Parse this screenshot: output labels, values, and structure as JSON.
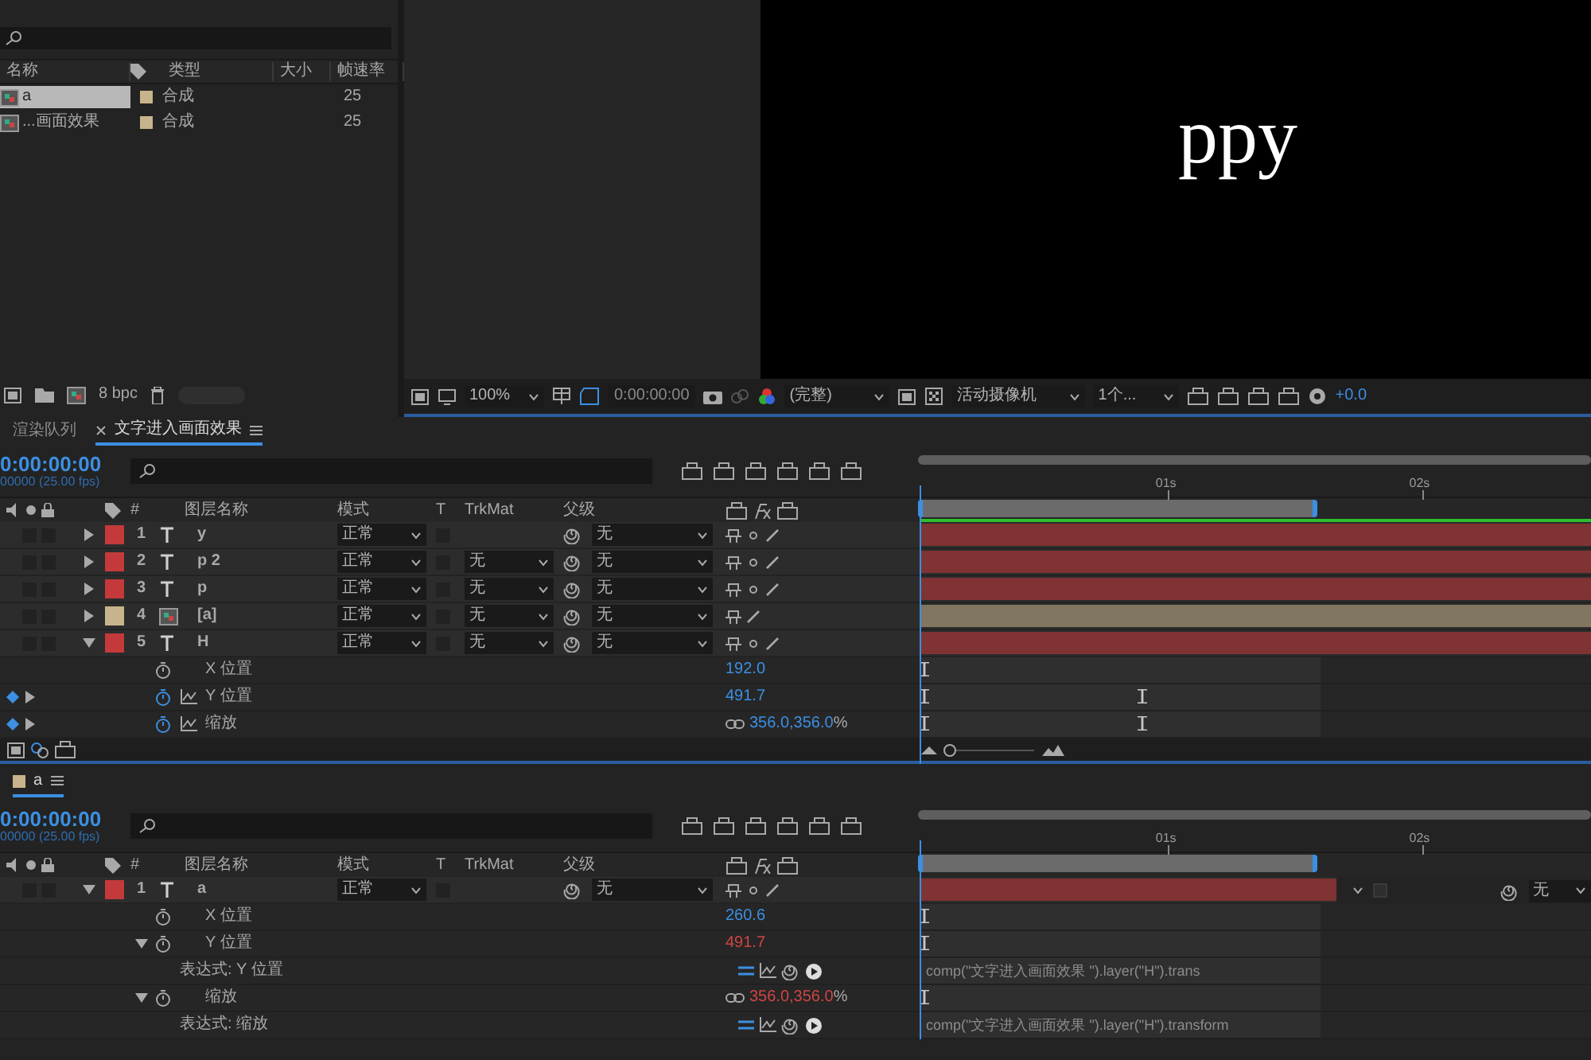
{
  "project": {
    "columns": [
      "名称",
      "类型",
      "大小",
      "帧速率"
    ],
    "items": [
      {
        "name": "a",
        "type": "合成",
        "fps": "25",
        "selected": true
      },
      {
        "name": "...画面效果",
        "type": "合成",
        "fps": "25",
        "selected": false
      }
    ],
    "bpc": "8 bpc"
  },
  "viewer": {
    "text": "ppy",
    "zoom": "100%",
    "timecode": "0:00:00:00",
    "resolution": "(完整)",
    "camera": "活动摄像机",
    "views": "1个...",
    "exposure": "+0.0"
  },
  "timelines": [
    {
      "tabs": [
        {
          "label": "渲染队列",
          "selected": false,
          "closable": false
        },
        {
          "label": "文字进入画面效果",
          "selected": true,
          "closable": true
        }
      ],
      "timecode": "0:00:00:00",
      "fps": "00000 (25.00 fps)",
      "headers": {
        "index": "#",
        "name": "图层名称",
        "mode": "模式",
        "t": "T",
        "trkmat": "TrkMat",
        "parent": "父级"
      },
      "ruler": [
        "01s",
        "02s"
      ],
      "layers": [
        {
          "index": "1",
          "kind": "text",
          "name": "y",
          "color": "#c43a3a",
          "expanded": false,
          "mode": "正常",
          "parent": "无"
        },
        {
          "index": "2",
          "kind": "text",
          "name": "p 2",
          "color": "#c43a3a",
          "expanded": false,
          "mode": "正常",
          "trkmat": "无",
          "parent": "无"
        },
        {
          "index": "3",
          "kind": "text",
          "name": "p",
          "color": "#c43a3a",
          "expanded": false,
          "mode": "正常",
          "trkmat": "无",
          "parent": "无"
        },
        {
          "index": "4",
          "kind": "comp",
          "name": "[a]",
          "color": "#c8b48c",
          "expanded": false,
          "mode": "正常",
          "trkmat": "无",
          "parent": "无"
        },
        {
          "index": "5",
          "kind": "text",
          "name": "H",
          "color": "#c43a3a",
          "expanded": true,
          "mode": "正常",
          "trkmat": "无",
          "parent": "无"
        }
      ],
      "properties": [
        {
          "kind": "property",
          "name": "X 位置",
          "animated": false,
          "graph": false,
          "value": "192.0",
          "expression": false
        },
        {
          "kind": "property",
          "name": "Y 位置",
          "animated": true,
          "graph": true,
          "value": "491.7",
          "expression": false
        },
        {
          "kind": "property",
          "name": "缩放",
          "animated": true,
          "graph": true,
          "linked": true,
          "value": "356.0,356.0",
          "unit": "%",
          "expression": false
        }
      ]
    },
    {
      "tabs": [
        {
          "label": "a",
          "color": "#c8b48c",
          "selected": true,
          "closable": false
        }
      ],
      "timecode": "0:00:00:00",
      "fps": "00000 (25.00 fps)",
      "headers": {
        "index": "#",
        "name": "图层名称",
        "mode": "模式",
        "t": "T",
        "trkmat": "TrkMat",
        "parent": "父级"
      },
      "ruler": [
        "01s",
        "02s"
      ],
      "layers": [
        {
          "index": "1",
          "kind": "text",
          "name": "a",
          "color": "#c43a3a",
          "expanded": true,
          "mode": "正常",
          "parent": "无"
        }
      ],
      "properties": [
        {
          "kind": "property",
          "name": "X 位置",
          "animated": false,
          "graph": false,
          "value": "260.6",
          "expression": false
        },
        {
          "kind": "property",
          "name": "Y 位置",
          "animated": false,
          "graph": false,
          "expanded": true,
          "value": "491.7",
          "expression": true
        },
        {
          "kind": "expression",
          "name": "表达式: Y 位置",
          "code": "comp(\"文字进入画面效果 \").layer(\"H\").trans"
        },
        {
          "kind": "property",
          "name": "缩放",
          "animated": false,
          "graph": false,
          "expanded": true,
          "linked": true,
          "value": "356.0,356.0",
          "unit": "%",
          "expression": true
        },
        {
          "kind": "expression",
          "name": "表达式: 缩放",
          "code": "comp(\"文字进入画面效果 \").layer(\"H\").transform"
        }
      ]
    }
  ],
  "overlay_dropdown": {
    "value": "无"
  }
}
